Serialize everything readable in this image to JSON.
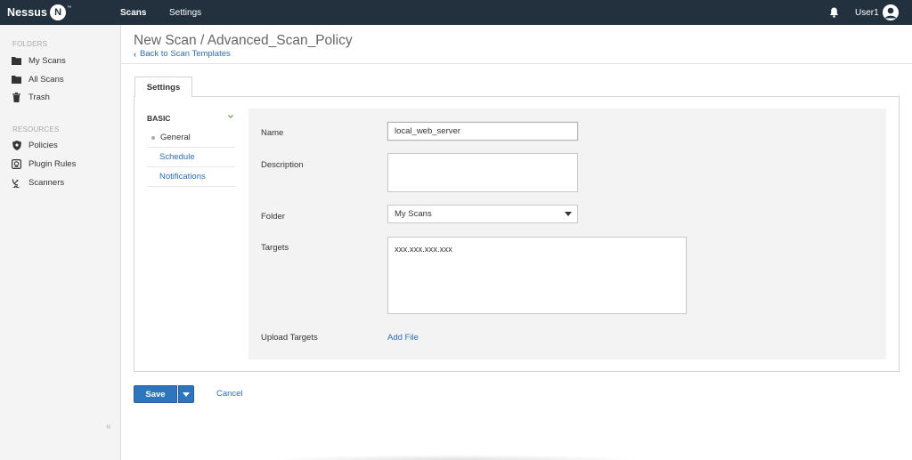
{
  "header": {
    "logo_text": "Nessus",
    "logo_badge": "N",
    "logo_tm": "™",
    "nav": {
      "scans": "Scans",
      "settings": "Settings"
    },
    "user_name": "User1",
    "icons": {
      "notifications": "bell-icon",
      "user": "user-avatar-icon"
    }
  },
  "sidebar": {
    "folders_heading": "FOLDERS",
    "folders": [
      {
        "label": "My Scans",
        "icon": "folder-icon"
      },
      {
        "label": "All Scans",
        "icon": "folder-icon"
      },
      {
        "label": "Trash",
        "icon": "trash-icon"
      }
    ],
    "resources_heading": "RESOURCES",
    "resources": [
      {
        "label": "Policies",
        "icon": "shield-icon"
      },
      {
        "label": "Plugin Rules",
        "icon": "plugin-rules-icon"
      },
      {
        "label": "Scanners",
        "icon": "satellite-dish-icon"
      }
    ],
    "collapse_glyph": "«"
  },
  "main": {
    "title": "New Scan / Advanced_Scan_Policy",
    "back_link": "Back to Scan Templates",
    "tabs": [
      {
        "label": "Settings",
        "active": true
      }
    ],
    "section": "BASIC",
    "subnav": [
      {
        "label": "General",
        "active": true
      },
      {
        "label": "Schedule",
        "active": false
      },
      {
        "label": "Notifications",
        "active": false
      }
    ],
    "form": {
      "name_label": "Name",
      "name_value": "local_web_server",
      "description_label": "Description",
      "description_value": "",
      "folder_label": "Folder",
      "folder_value": "My Scans",
      "targets_label": "Targets",
      "targets_value": "xxx.xxx.xxx.xxx",
      "upload_label": "Upload Targets",
      "upload_link": "Add File"
    },
    "actions": {
      "save": "Save",
      "cancel": "Cancel"
    }
  },
  "colors": {
    "topbar": "#23313f",
    "link": "#2a6ebb",
    "primary_button": "#2e75c0",
    "sidebar_bg": "#f4f4f4",
    "form_bg": "#f3f3f3"
  }
}
